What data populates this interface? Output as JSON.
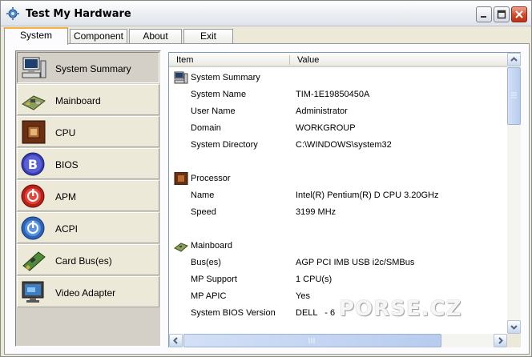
{
  "window": {
    "title": "Test My  Hardware"
  },
  "tabs": [
    {
      "label": "System",
      "active": true
    },
    {
      "label": "Component",
      "active": false
    },
    {
      "label": "About",
      "active": false
    },
    {
      "label": "Exit",
      "active": false
    }
  ],
  "sidebar": {
    "items": [
      {
        "label": "System Summary",
        "icon": "computer-icon",
        "selected": true
      },
      {
        "label": "Mainboard",
        "icon": "mainboard-icon",
        "selected": false
      },
      {
        "label": "CPU",
        "icon": "cpu-chip-icon",
        "selected": false
      },
      {
        "label": "BIOS",
        "icon": "bios-b-icon",
        "selected": false
      },
      {
        "label": "APM",
        "icon": "power-icon",
        "selected": false
      },
      {
        "label": "ACPI",
        "icon": "acpi-power-icon",
        "selected": false
      },
      {
        "label": "Card Bus(es)",
        "icon": "expansion-card-icon",
        "selected": false
      },
      {
        "label": "Video Adapter",
        "icon": "monitor-icon",
        "selected": false
      }
    ]
  },
  "list": {
    "columns": {
      "item": "Item",
      "value": "Value"
    },
    "groups": [
      {
        "name": "System Summary",
        "icon": "computer-icon",
        "rows": [
          {
            "item": "System Name",
            "value": "TIM-1E19850450A"
          },
          {
            "item": "User Name",
            "value": "Administrator"
          },
          {
            "item": "Domain",
            "value": "WORKGROUP"
          },
          {
            "item": "System Directory",
            "value": "C:\\WINDOWS\\system32"
          }
        ]
      },
      {
        "name": "Processor",
        "icon": "cpu-chip-icon",
        "rows": [
          {
            "item": "Name",
            "value": "Intel(R) Pentium(R) D CPU 3.20GHz"
          },
          {
            "item": "Speed",
            "value": "3199 MHz"
          }
        ]
      },
      {
        "name": "Mainboard",
        "icon": "mainboard-icon",
        "rows": [
          {
            "item": "Bus(es)",
            "value": "AGP PCI IMB USB i2c/SMBus"
          },
          {
            "item": "MP Support",
            "value": "1 CPU(s)"
          },
          {
            "item": "MP APIC",
            "value": "Yes"
          },
          {
            "item": "System BIOS Version",
            "value": "DELL   - 6"
          }
        ]
      }
    ]
  },
  "watermark": {
    "text": "PORSE.CZ"
  },
  "colors": {
    "tab_accent": "#f7b03b",
    "close_button": "#d0492c",
    "list_border": "#7f9db9"
  }
}
